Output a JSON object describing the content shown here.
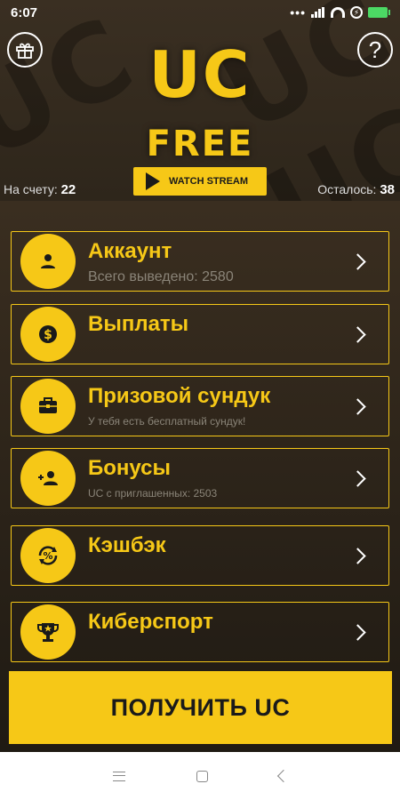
{
  "status_bar": {
    "time": "6:07"
  },
  "header": {
    "logo_line1": "UC",
    "logo_line2": "FREE",
    "watch_stream_label": "WATCH STREAM",
    "balance_label": "На счету:",
    "balance_value": "22",
    "remaining_label": "Осталось:",
    "remaining_value": "38",
    "progress_fraction": 0.36
  },
  "menu": {
    "items": [
      {
        "title": "Аккаунт",
        "subtitle": "Всего выведено: 2580",
        "icon": "person-icon"
      },
      {
        "title": "Выплаты",
        "subtitle": "",
        "icon": "dollar-icon"
      },
      {
        "title": "Призовой сундук",
        "subtitle": "У тебя есть бесплатный сундук!",
        "icon": "chest-icon"
      },
      {
        "title": "Бонусы",
        "subtitle": "UC с приглашенных: 2503",
        "icon": "add-person-icon"
      },
      {
        "title": "Кэшбэк",
        "subtitle": "",
        "icon": "percent-refresh-icon"
      },
      {
        "title": "Киберспорт",
        "subtitle": "",
        "icon": "trophy-icon"
      }
    ]
  },
  "get_button_label": "ПОЛУЧИТЬ UC",
  "colors": {
    "accent": "#f6c817",
    "background": "#2b2419",
    "subtitle": "#8a8478"
  }
}
